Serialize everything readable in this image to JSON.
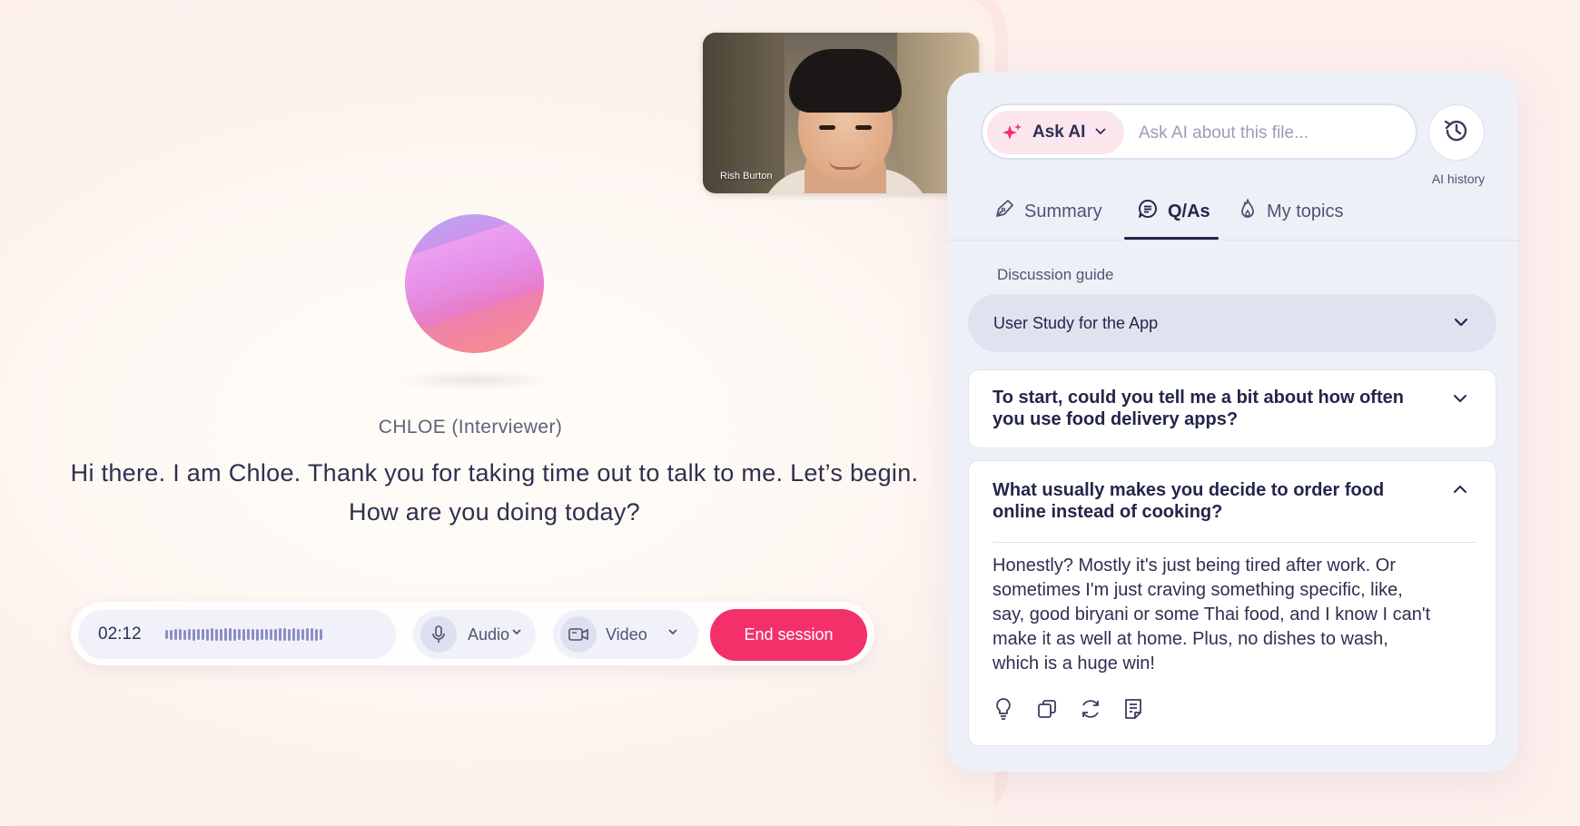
{
  "video": {
    "participant_name": "Rish Burton"
  },
  "interviewer": {
    "speaker_label": "CHLOE (Interviewer)",
    "speech_line1": "Hi there. I am Chloe. Thank you for taking time out to talk to me. Let’s begin.",
    "speech_line2": "How are you doing today?"
  },
  "controls": {
    "timer": "02:12",
    "audio_label": "Audio",
    "video_label": "Video",
    "end_session_label": "End session"
  },
  "ask_ai": {
    "button_label": "Ask AI",
    "input_placeholder": "Ask AI about this file...",
    "history_label": "AI history"
  },
  "tabs": [
    {
      "label": "Summary",
      "icon": "pen-icon"
    },
    {
      "label": "Q/As",
      "icon": "chat-list-icon",
      "active": true
    },
    {
      "label": "My topics",
      "icon": "flame-icon"
    }
  ],
  "discussion_guide": {
    "label": "Discussion guide",
    "selected": "User Study for the App"
  },
  "questions": [
    {
      "line1": "To start, could you tell me a bit about how often",
      "line2": "you use food delivery apps?",
      "expanded": false
    },
    {
      "line1": "What usually makes you decide to order food",
      "line2": "online instead of cooking?",
      "expanded": true,
      "answer_lines": [
        "Honestly? Mostly it's just being tired after work. Or",
        "sometimes I'm just craving something specific, like,",
        "say, good biryani or some Thai food, and I know I can't",
        "make it as well at home. Plus, no dishes to wash,",
        "which is a huge win!"
      ]
    }
  ],
  "answer_actions": [
    "lightbulb-icon",
    "copy-icon",
    "refresh-icon",
    "notes-icon"
  ],
  "colors": {
    "accent_pink": "#f3306a",
    "text_dark": "#23264a",
    "panel_bg": "#eef0f8"
  }
}
